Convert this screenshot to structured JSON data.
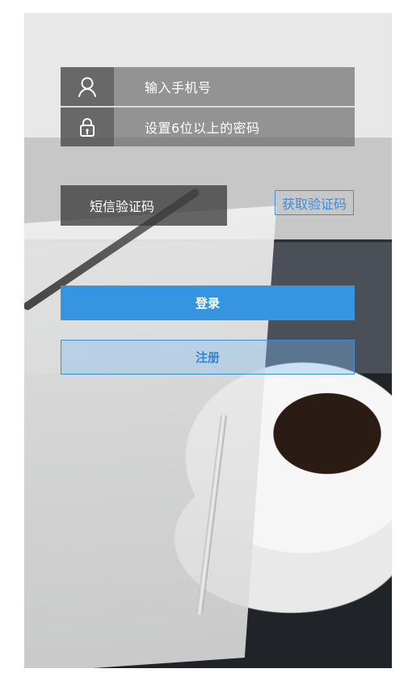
{
  "form": {
    "phone_placeholder": "输入手机号",
    "password_placeholder": "设置6位以上的密码",
    "sms_code_placeholder": "短信验证码",
    "get_code_button": "获取验证码",
    "login_button": "登录",
    "register_button": "注册"
  },
  "colors": {
    "primary": "#3595E0",
    "outline": "#3B8FDC"
  },
  "icons": {
    "phone_field_icon": "user-icon",
    "password_field_icon": "lock-icon"
  }
}
